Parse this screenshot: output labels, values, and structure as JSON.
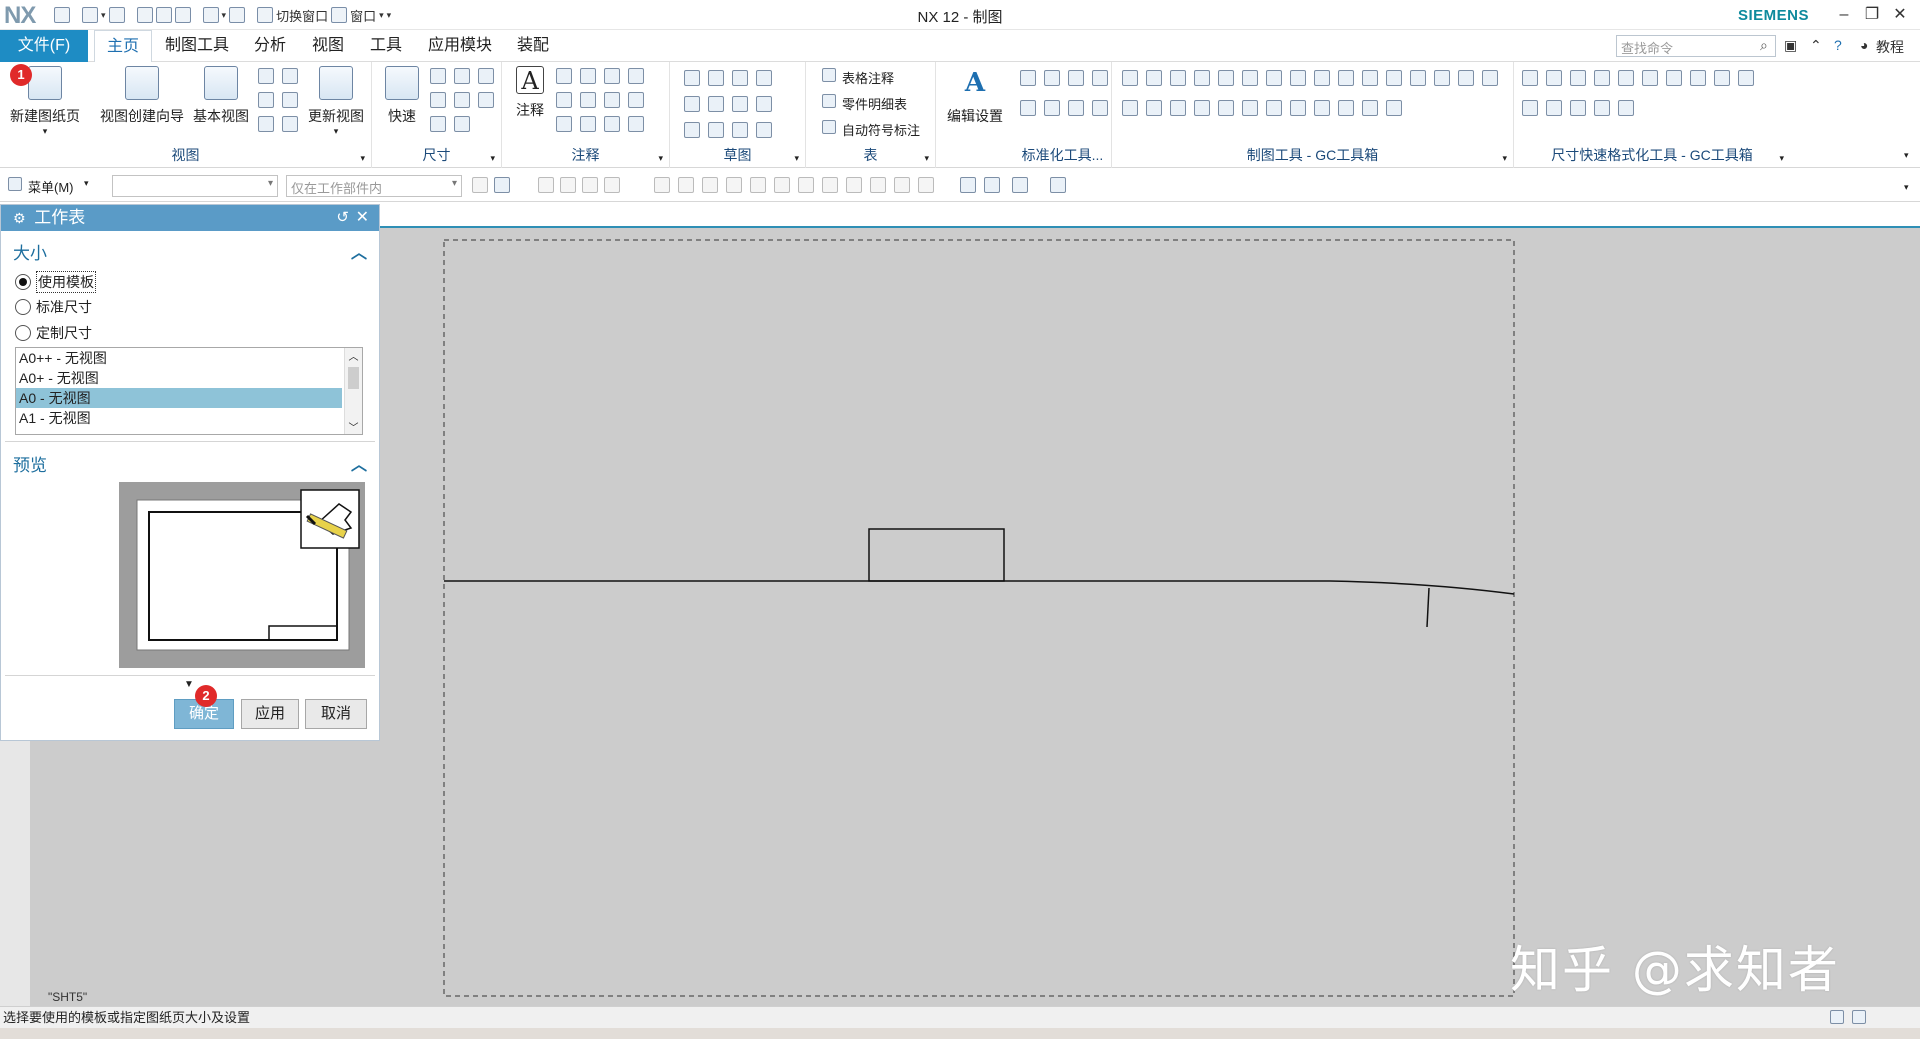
{
  "titlebar": {
    "logo": "NX",
    "quick_switch": "切换窗口",
    "window_menu": "窗口",
    "title": "NX 12 - 制图",
    "brand": "SIEMENS"
  },
  "menu": {
    "file": "文件(F)",
    "tabs": [
      "主页",
      "制图工具",
      "分析",
      "视图",
      "工具",
      "应用模块",
      "装配"
    ],
    "search_placeholder": "查找命令",
    "tutorial": "教程"
  },
  "ribbon": {
    "new_sheet": "新建图纸页",
    "view_wizard": "视图创建向导",
    "base_view": "基本视图",
    "update_views": "更新视图",
    "group_view": "视图",
    "quick": "快速",
    "group_dim": "尺寸",
    "note": "注释",
    "group_annot": "注释",
    "group_sketch": "草图",
    "table_note": "表格注释",
    "parts_list": "零件明细表",
    "auto_balloon": "自动符号标注",
    "group_table": "表",
    "edit_settings": "编辑设置",
    "group_std": "标准化工具...",
    "group_gc": "制图工具 - GC工具箱",
    "group_dimfmt": "尺寸快速格式化工具 - GC工具箱"
  },
  "toolbar2": {
    "menu": "菜单(M)",
    "filter_placeholder": "仅在工作部件内"
  },
  "dialog": {
    "title": "工作表",
    "size_section": "大小",
    "options": [
      "使用模板",
      "标准尺寸",
      "定制尺寸"
    ],
    "selected_option": "使用模板",
    "templates": [
      "A0++ - 无视图",
      "A0+ - 无视图",
      "A0 - 无视图",
      "A1 - 无视图"
    ],
    "selected_template": "A0 - 无视图",
    "preview_section": "预览",
    "ok": "确定",
    "apply": "应用",
    "cancel": "取消",
    "badge1": "1",
    "badge2": "2"
  },
  "canvas": {
    "sheet_name": "\"SHT5\""
  },
  "status": {
    "message": "选择要使用的模板或指定图纸页大小及设置"
  },
  "watermark": "知乎 @求知者",
  "colors": {
    "file_button": "#1e8cc4",
    "dialog_header": "#5a9bc7",
    "selection": "#8ec3d8",
    "brand": "#0e8a9d",
    "canvas": "#cccccc",
    "badge": "#e02a2a"
  }
}
